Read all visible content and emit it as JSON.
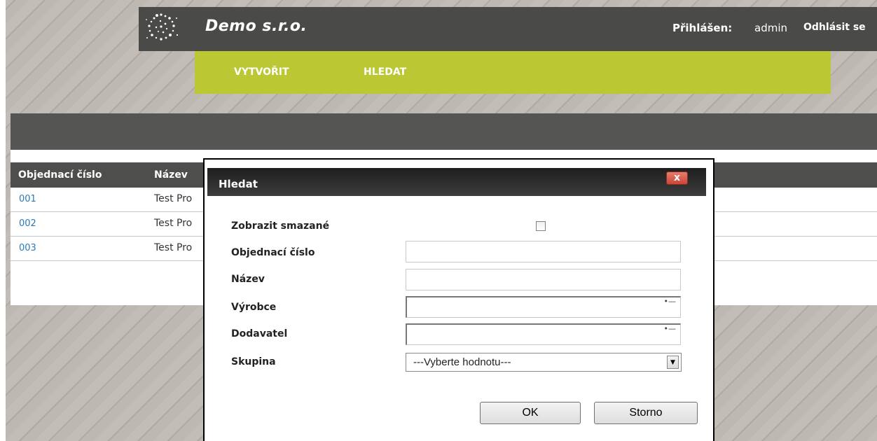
{
  "header": {
    "company": "Demo s.r.o.",
    "logged_in_label": "Přihlášen:",
    "user": "admin",
    "logout": "Odhlásit se"
  },
  "nav": {
    "items": [
      {
        "label": "VYTVOŘIT"
      },
      {
        "label": "HLEDAT"
      }
    ]
  },
  "table": {
    "columns": [
      "Objednací číslo",
      "Název"
    ],
    "rows": [
      {
        "order_no": "001",
        "name": "Test Pro"
      },
      {
        "order_no": "002",
        "name": "Test Pro"
      },
      {
        "order_no": "003",
        "name": "Test Pro"
      }
    ]
  },
  "dialog": {
    "title": "Hledat",
    "close_label": "x",
    "fields": {
      "show_deleted": {
        "label": "Zobrazit smazané",
        "checked": false
      },
      "order_no": {
        "label": "Objednací číslo",
        "value": ""
      },
      "name": {
        "label": "Název",
        "value": ""
      },
      "manufacturer": {
        "label": "Výrobce",
        "value": ""
      },
      "supplier": {
        "label": "Dodavatel",
        "value": ""
      },
      "group": {
        "label": "Skupina",
        "selected": "---Vyberte hodnotu---"
      }
    },
    "ok_label": "OK",
    "cancel_label": "Storno"
  },
  "colors": {
    "nav_green": "#bcc734",
    "header_dark": "#4a4a48",
    "link_blue": "#2a79b8"
  },
  "icons": {
    "logo": "swirl-dots-logo",
    "close": "close-icon",
    "lookup": "list-lookup-icon",
    "dropdown": "chevron-down-icon"
  }
}
